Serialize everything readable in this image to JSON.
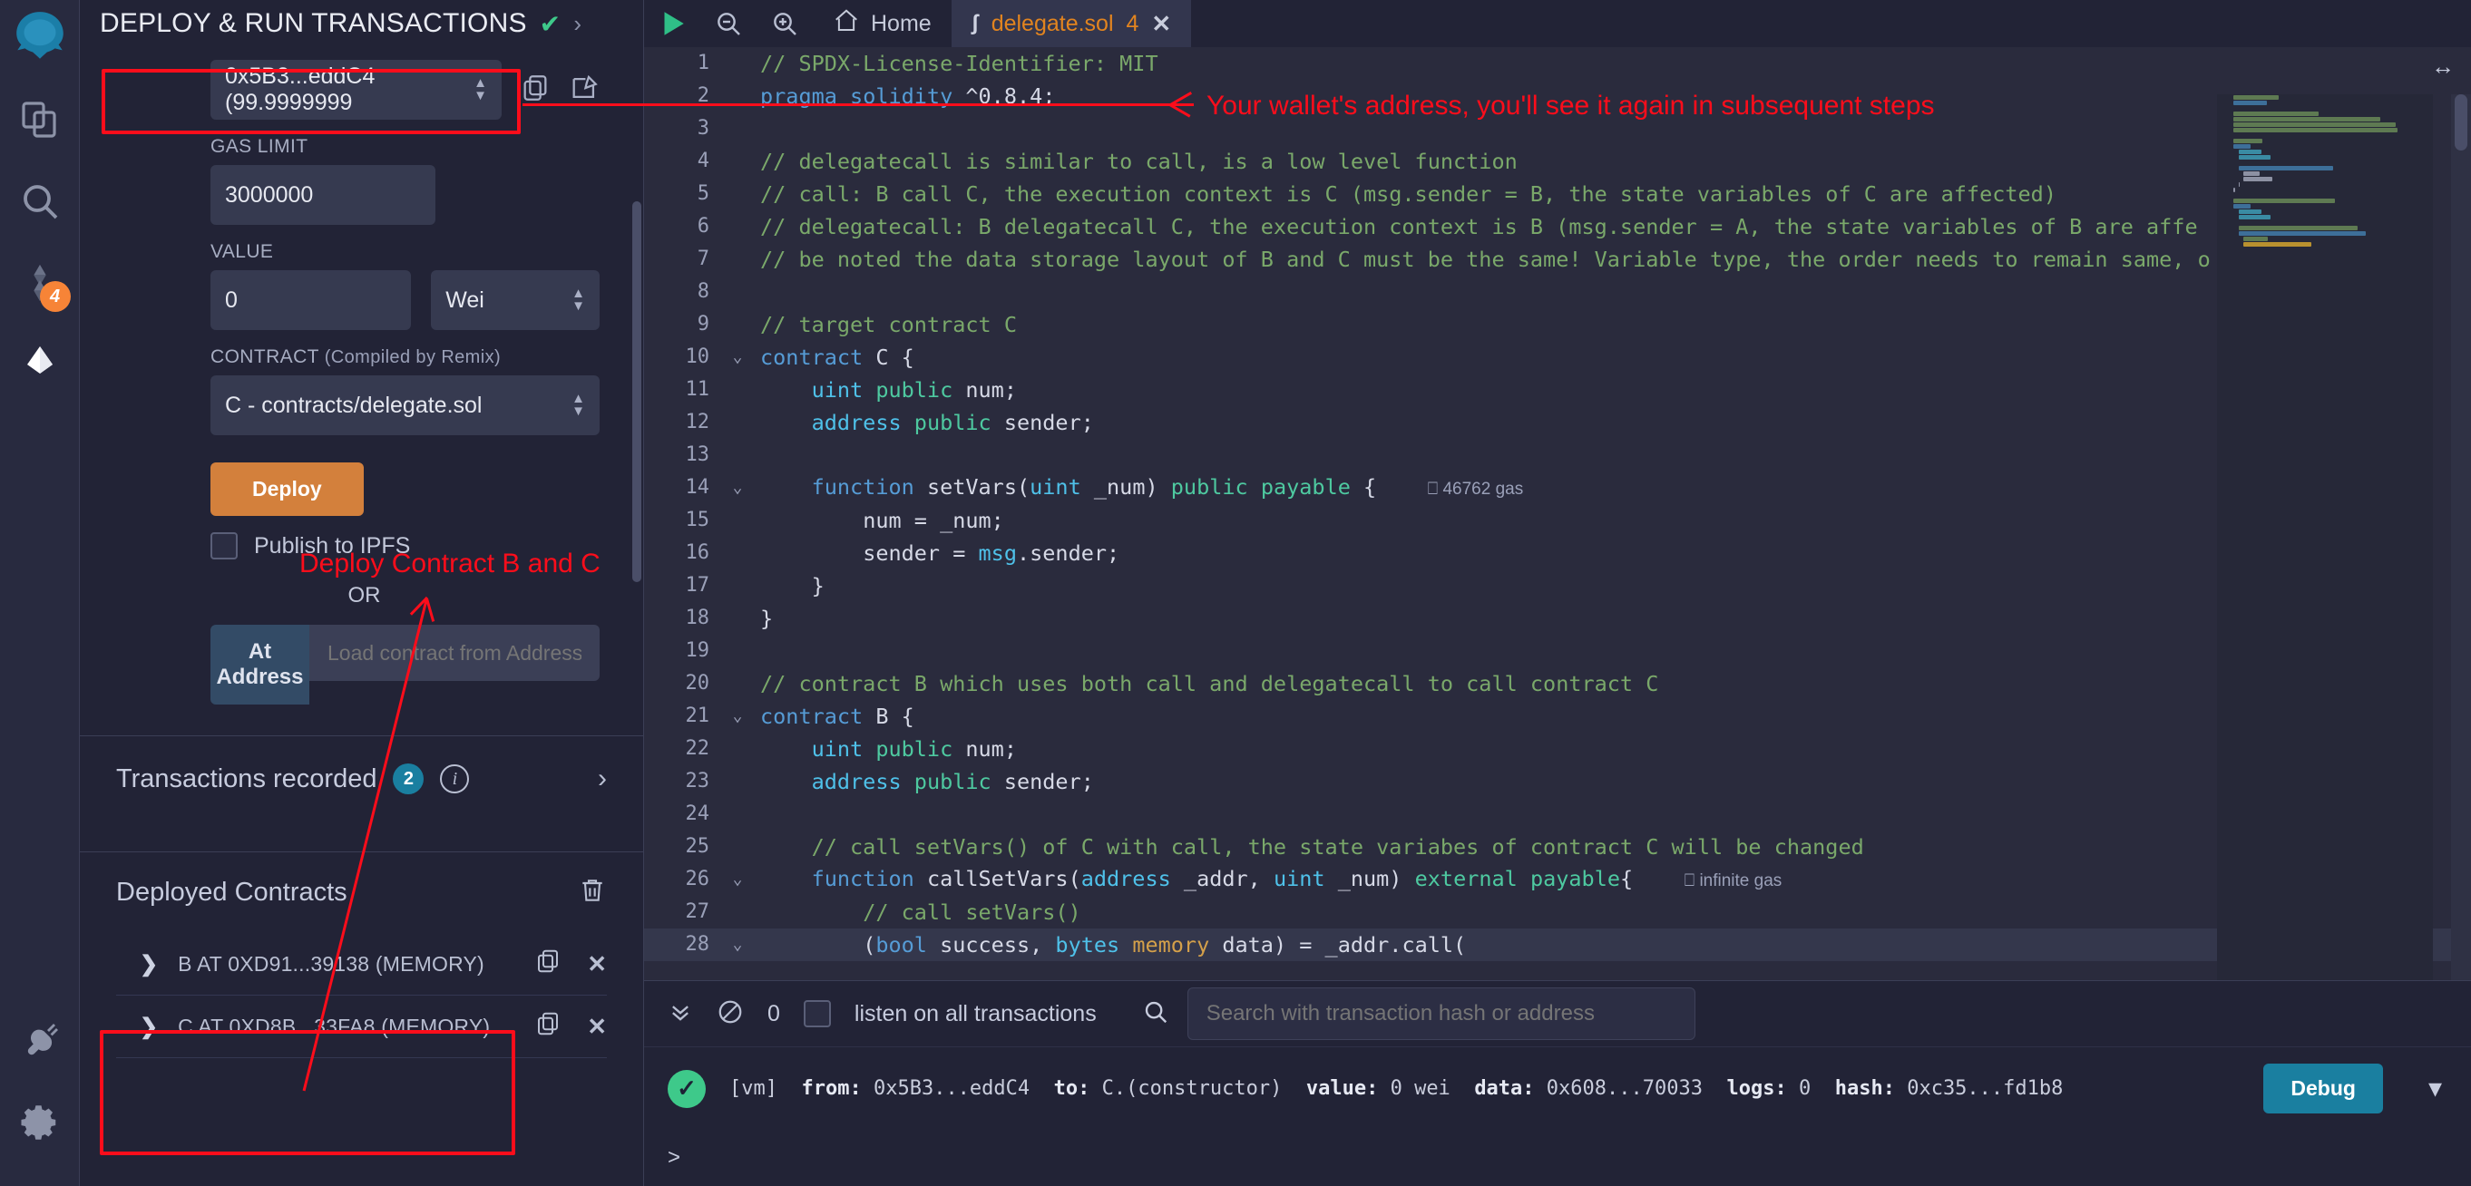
{
  "iconbar": {
    "items": [
      {
        "name": "remix-logo",
        "label": "Remix"
      },
      {
        "name": "file-explorer-icon",
        "label": "File explorer"
      },
      {
        "name": "search-icon",
        "label": "Search in files"
      },
      {
        "name": "solidity-compiler-icon",
        "label": "Solidity compiler",
        "badge": "4"
      },
      {
        "name": "deploy-run-icon",
        "label": "Deploy & run transactions"
      },
      {
        "name": "plugin-manager-icon",
        "label": "Plugin manager"
      },
      {
        "name": "settings-icon",
        "label": "Settings"
      }
    ]
  },
  "panel": {
    "title": "DEPLOY & RUN TRANSACTIONS",
    "status_icon": "check-icon",
    "expand_icon": "chevron-right-icon",
    "account": {
      "value": "0x5B3...eddC4 (99.9999999",
      "copy_icon": "copy-icon",
      "edit_icon": "edit-icon"
    },
    "gas_limit": {
      "label": "GAS LIMIT",
      "value": "3000000"
    },
    "value": {
      "label": "VALUE",
      "amount": "0",
      "unit": "Wei"
    },
    "contract": {
      "label": "CONTRACT",
      "sublabel": "(Compiled by Remix)",
      "selected": "C - contracts/delegate.sol"
    },
    "deploy_label": "Deploy",
    "publish_ipfs_label": "Publish to IPFS",
    "or_label": "OR",
    "at_address_label": "At Address",
    "at_address_placeholder": "Load contract from Address",
    "transactions": {
      "title": "Transactions recorded",
      "count": "2",
      "info_icon": "info-icon",
      "chevron_icon": "chevron-right-icon"
    },
    "deployed": {
      "title": "Deployed Contracts",
      "trash_icon": "trash-icon",
      "items": [
        {
          "label": "B AT 0XD91...39138 (MEMORY)",
          "copy_icon": "copy-icon",
          "close_icon": "close-icon"
        },
        {
          "label": "C AT 0XD8B...33FA8 (MEMORY)",
          "copy_icon": "copy-icon",
          "close_icon": "close-icon"
        }
      ]
    }
  },
  "editor": {
    "toolbar": {
      "run_icon": "play-icon",
      "zoom_out_icon": "zoom-out-icon",
      "zoom_in_icon": "zoom-in-icon",
      "home_label": "Home",
      "home_icon": "home-icon"
    },
    "tab": {
      "file_icon": "solidity-file-icon",
      "name": "delegate.sol",
      "count": "4",
      "close_icon": "close-icon"
    },
    "resize_icon": "horizontal-resize-icon",
    "lines": [
      {
        "n": "1",
        "fold": "",
        "html": "<span class='k-com'>// SPDX-License-Identifier: MIT</span>"
      },
      {
        "n": "2",
        "fold": "",
        "html": "<span class='k-kw'>pragma</span> <span class='k-kw'>solidity</span> <span class='k-pl'>^0.8.4;</span>"
      },
      {
        "n": "3",
        "fold": "",
        "html": ""
      },
      {
        "n": "4",
        "fold": "",
        "html": "<span class='k-com'>// delegatecall is similar to call, is a low level function</span>"
      },
      {
        "n": "5",
        "fold": "",
        "html": "<span class='k-com'>// call: B call C, the execution context is C (msg.sender = B, the state variables of C are affected)</span>"
      },
      {
        "n": "6",
        "fold": "",
        "html": "<span class='k-com'>// delegatecall: B delegatecall C, the execution context is B (msg.sender = A, the state variables of B are affe</span>"
      },
      {
        "n": "7",
        "fold": "",
        "html": "<span class='k-com'>// be noted the data storage layout of B and C must be the same! Variable type, the order needs to remain same, o</span>"
      },
      {
        "n": "8",
        "fold": "",
        "html": ""
      },
      {
        "n": "9",
        "fold": "",
        "html": "<span class='k-com'>// target contract C</span>"
      },
      {
        "n": "10",
        "fold": "v",
        "html": "<span class='k-kw'>contract</span> <span class='k-pl'>C {</span>"
      },
      {
        "n": "11",
        "fold": "",
        "html": "    <span class='k-ty'>uint</span> <span class='k-mod'>public</span> <span class='k-pl'>num;</span>"
      },
      {
        "n": "12",
        "fold": "",
        "html": "    <span class='k-ty'>address</span> <span class='k-mod'>public</span> <span class='k-pl'>sender;</span>"
      },
      {
        "n": "13",
        "fold": "",
        "html": ""
      },
      {
        "n": "14",
        "fold": "v",
        "html": "    <span class='k-kw'>function</span> <span class='k-pl'>setVars(</span><span class='k-ty'>uint</span> <span class='k-pl'>_num)</span> <span class='k-mod'>public</span> <span class='k-mod'>payable</span> <span class='k-pl'>{</span>    <span class='gas'>&#9109; 46762 gas</span>"
      },
      {
        "n": "15",
        "fold": "",
        "html": "        <span class='k-pl'>num = _num;</span>"
      },
      {
        "n": "16",
        "fold": "",
        "html": "        <span class='k-pl'>sender = </span><span class='k-ty'>msg</span><span class='k-pl'>.sender;</span>"
      },
      {
        "n": "17",
        "fold": "",
        "html": "    <span class='k-pl'>}</span>"
      },
      {
        "n": "18",
        "fold": "",
        "html": "<span class='k-pl'>}</span>"
      },
      {
        "n": "19",
        "fold": "",
        "html": ""
      },
      {
        "n": "20",
        "fold": "",
        "html": "<span class='k-com'>// contract B which uses both call and delegatecall to call contract C</span>"
      },
      {
        "n": "21",
        "fold": "v",
        "html": "<span class='k-kw'>contract</span> <span class='k-pl'>B {</span>"
      },
      {
        "n": "22",
        "fold": "",
        "html": "    <span class='k-ty'>uint</span> <span class='k-mod'>public</span> <span class='k-pl'>num;</span>"
      },
      {
        "n": "23",
        "fold": "",
        "html": "    <span class='k-ty'>address</span> <span class='k-mod'>public</span> <span class='k-pl'>sender;</span>"
      },
      {
        "n": "24",
        "fold": "",
        "html": ""
      },
      {
        "n": "25",
        "fold": "",
        "html": "    <span class='k-com'>// call setVars() of C with call, the state variabes of contract C will be changed</span>"
      },
      {
        "n": "26",
        "fold": "v",
        "html": "    <span class='k-kw'>function</span> <span class='k-pl'>callSetVars(</span><span class='k-ty'>address</span> <span class='k-pl'>_addr, </span><span class='k-ty'>uint</span> <span class='k-pl'>_num)</span> <span class='k-mod'>external</span> <span class='k-mod'>payable</span><span class='k-pl'>{</span>    <span class='gas'>&#9109; infinite gas</span>"
      },
      {
        "n": "27",
        "fold": "",
        "html": "        <span class='k-com'>// call setVars()</span>"
      },
      {
        "n": "28",
        "fold": "v",
        "html": "        <span class='k-pl'>(</span><span class='k-kw'>bool</span><span class='k-pl'> success, </span><span class='k-ty'>bytes</span> <span class='k-or'>memory</span><span class='k-pl'> data) = _addr.call(</span>",
        "hl": true
      }
    ]
  },
  "terminal": {
    "collapse_icon": "double-chevron-down-icon",
    "clear_icon": "ban-icon",
    "count": "0",
    "listen_label": "listen on all transactions",
    "search_icon": "search-icon",
    "search_placeholder": "Search with transaction hash or address",
    "log": {
      "status_icon": "success-check-icon",
      "source": "[vm]",
      "from_label": "from:",
      "from_value": "0x5B3...eddC4",
      "to_label": "to:",
      "to_value": "C.(constructor)",
      "value_label": "value:",
      "value_value": "0 wei",
      "data_label": "data:",
      "data_value": "0x608...70033",
      "logs_label": "logs:",
      "logs_value": "0",
      "hash_label": "hash:",
      "hash_value": "0xc35...fd1b8",
      "debug_label": "Debug",
      "expand_icon": "chevron-down-icon"
    },
    "prompt": ">"
  },
  "annotations": {
    "wallet_note": "Your wallet's address, you'll see it again in subsequent steps",
    "deploy_note": "Deploy Contract B and C",
    "color": "#fc0d1b"
  }
}
